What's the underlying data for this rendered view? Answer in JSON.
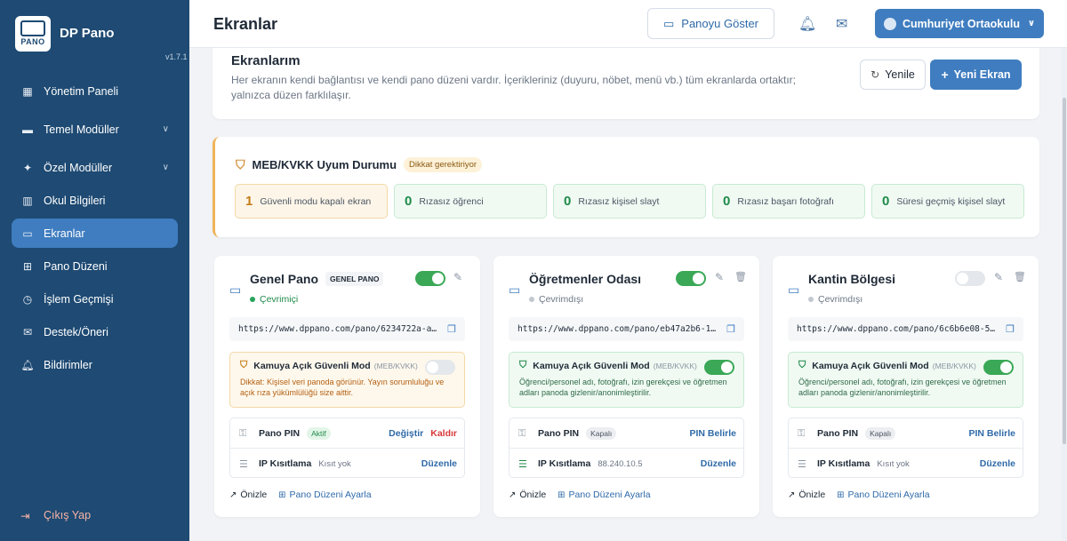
{
  "app": {
    "name": "DP Pano",
    "version": "v1.7.1",
    "logo_text": "PANO"
  },
  "sidebar": {
    "items": [
      {
        "label": "Yönetim Paneli",
        "icon": "grid-icon"
      },
      {
        "label": "Temel Modüller",
        "icon": "briefcase-icon"
      },
      {
        "label": "Özel Modüller",
        "icon": "sparkle-icon"
      },
      {
        "label": "Okul Bilgileri",
        "icon": "building-icon"
      },
      {
        "label": "Ekranlar",
        "icon": "monitor-icon",
        "active": true
      },
      {
        "label": "Pano Düzeni",
        "icon": "layout-icon"
      },
      {
        "label": "İşlem Geçmişi",
        "icon": "clock-icon"
      },
      {
        "label": "Destek/Öneri",
        "icon": "mail-icon"
      },
      {
        "label": "Bildirimler",
        "icon": "bell-icon"
      }
    ],
    "logout": "Çıkış Yap"
  },
  "header": {
    "title": "Ekranlar",
    "show_board": "Panoyu Göster",
    "user": "Cumhuriyet Ortaokulu"
  },
  "screens_panel": {
    "title": "Ekranlarım",
    "desc": "Her ekranın kendi bağlantısı ve kendi pano düzeni vardır. İçerikleriniz (duyuru, nöbet, menü vb.) tüm ekranlarda ortaktır; yalnızca düzen farklılaşır.",
    "refresh": "Yenile",
    "new": "Yeni Ekran"
  },
  "compliance": {
    "title": "MEB/KVKK Uyum Durumu",
    "badge": "Dikkat gerektiriyor",
    "stats": [
      {
        "num": "1",
        "label": "Güvenli modu kapalı ekran",
        "warn": true
      },
      {
        "num": "0",
        "label": "Rızasız öğrenci"
      },
      {
        "num": "0",
        "label": "Rızasız kişisel slayt"
      },
      {
        "num": "0",
        "label": "Rızasız başarı fotoğrafı"
      },
      {
        "num": "0",
        "label": "Süresi geçmiş kişisel slayt"
      }
    ]
  },
  "common": {
    "safe_mode": "Kamuya Açık Güvenli Mod",
    "safe_mode_sub": "(MEB/KVKK)",
    "pin": "Pano PIN",
    "ip": "IP Kısıtlama",
    "preview": "Önizle",
    "layout": "Pano Düzeni Ayarla",
    "change": "Değiştir",
    "remove": "Kaldır",
    "set_pin": "PIN Belirle",
    "edit": "Düzenle"
  },
  "cards": [
    {
      "name": "Genel Pano",
      "tag": "GENEL PANO",
      "status": "Çevrimiçi",
      "url": "https://www.dppano.com/pano/6234722a-ab0…",
      "safe_desc": "Dikkat: Kişisel veri panoda görünür. Yayın sorumluluğu ve açık rıza yükümlülüğü size aittir.",
      "pin_state": "Aktif",
      "ip_value": "Kısıt yok"
    },
    {
      "name": "Öğretmenler Odası",
      "status": "Çevrimdışı",
      "url": "https://www.dppano.com/pano/eb47a2b6-1de…",
      "safe_desc": "Öğrenci/personel adı, fotoğrafı, izin gerekçesi ve öğretmen adları panoda gizlenir/anonimleştirilir.",
      "pin_state": "Kapalı",
      "ip_value": "88.240.10.5"
    },
    {
      "name": "Kantin Bölgesi",
      "status": "Çevrimdışı",
      "url": "https://www.dppano.com/pano/6c6b6e08-537…",
      "safe_desc": "Öğrenci/personel adı, fotoğrafı, izin gerekçesi ve öğretmen adları panoda gizlenir/anonimleştirilir.",
      "pin_state": "Kapalı",
      "ip_value": "Kısıt yok"
    }
  ]
}
